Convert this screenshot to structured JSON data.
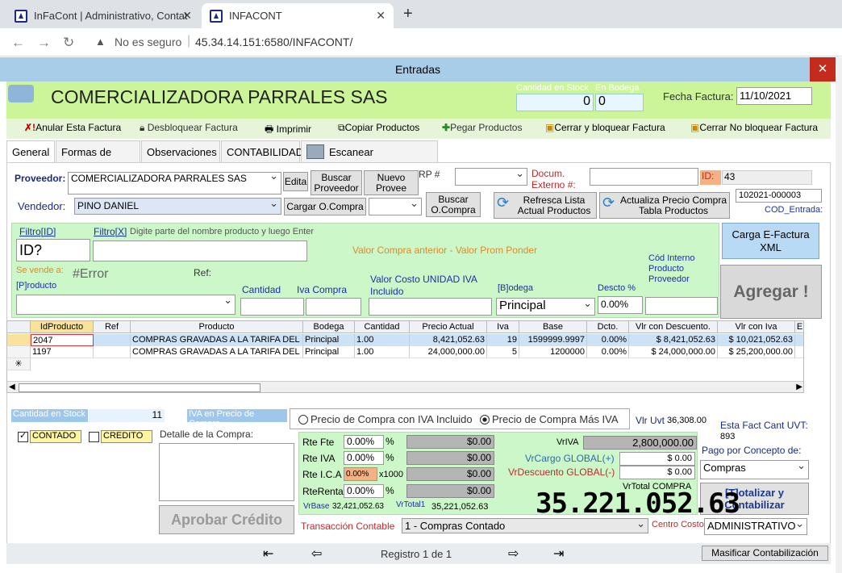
{
  "browser": {
    "tab1": "InFaCont | Administrativo, Contat",
    "tab2": "INFACONT",
    "new_tab": "+",
    "not_secure": "No es seguro",
    "url": "45.34.14.151:6580/INFACONT/"
  },
  "window": {
    "title": "Entradas",
    "close": "✕"
  },
  "header": {
    "company": "COMERCIALIZADORA PARRALES SAS",
    "stock_label": "Cantidad en Stock",
    "stock_value": "0",
    "warehouse_label": "En Bodega",
    "warehouse_value": "0",
    "invoice_date_label": "Fecha Factura:",
    "invoice_date": "11/10/2021"
  },
  "toolbar": {
    "cancel": "Anular Esta Factura",
    "unlock": "Desbloquear Factura",
    "print": "Imprimir",
    "copy": "Copiar Productos",
    "paste": "Pegar Productos",
    "close_lock": "Cerrar y bloquear Factura",
    "close_nolock": "Cerrar No bloquear Factura"
  },
  "tabs": [
    "General",
    "Formas de Pago",
    "Observaciones",
    "CONTABILIDAD",
    "Escanear Documentos"
  ],
  "form": {
    "supplier_label": "Proveedor:",
    "supplier": "COMERCIALIZADORA PARRALES SAS",
    "edit": "Edita",
    "search_supplier": "Buscar Proveedor",
    "new_supplier": "Nuevo Provee",
    "rp_label": "RP #",
    "external_doc_label": "Docum. Externo #:",
    "id_label": "ID:",
    "id_value": "43",
    "seller_label": "Vendedor:",
    "seller": "PINO DANIEL",
    "load_po": "Cargar O.Compra",
    "search_po": "Buscar O.Compra",
    "refresh": "Refresca Lista Actual Productos",
    "update_price": "Actualiza Precio Compra Tabla Productos",
    "cod_value": "102021-000003",
    "cod_label": "COD_Entrada:"
  },
  "product": {
    "filter_id_label": "Filtro[ID]",
    "filter_id": "ID?",
    "filter_x_label": "Filtro[X]",
    "filter_x_hint": "Digite parte del nombre producto y luego Enter",
    "prev_value": "Valor Compra anterior - Valor Prom Ponder",
    "sold_as": "Se vende a:",
    "error": "#Error",
    "ref": "Ref:",
    "product_label": "[P]roducto",
    "qty_label": "Cantidad",
    "iva_label": "Iva Compra",
    "unit_cost_label": "Valor Costo UNIDAD IVA Incluido",
    "warehouse_label": "[B]odega",
    "warehouse": "Principal",
    "disc_label": "Descto %",
    "discount": "0.00%",
    "code_label": "Cód Interno Producto Proveedor",
    "xml": "Carga E-Factura XML",
    "add": "Agregar !"
  },
  "grid": {
    "headers": [
      "IdProducto",
      "Ref",
      "Producto",
      "Bodega",
      "Cantidad",
      "Precio Actual",
      "Iva",
      "Base",
      "Dcto.",
      "Vlr con Descuento.",
      "Vlr con Iva",
      "E"
    ],
    "rows": [
      [
        "2047",
        "",
        "COMPRAS GRAVADAS A LA TARIFA DEL",
        "Principal",
        "1.00",
        "8,421,052.63",
        "19",
        "1599999.9997",
        "0.00%",
        "$ 8,421,052.63",
        "$ 10,021,052.63"
      ],
      [
        "1197",
        "",
        "COMPRAS GRAVADAS A LA TARIFA DEL",
        "Principal",
        "1.00",
        "24,000,000.00",
        "5",
        "1200000",
        "0.00%",
        "$ 24,000,000.00",
        "$ 25,200,000.00"
      ]
    ]
  },
  "footer": {
    "stock_label": "Cantidad en Stock",
    "stock": "11",
    "iva_price_label": "IVA en Precio de Compra",
    "cash": "CONTADO",
    "credit": "CREDITO",
    "detail_label": "Detalle de la Compra:",
    "approve": "Aprobar Crédito",
    "radio1": "Precio de Compra con IVA Incluido",
    "radio2": "Precio de Compra Más IVA",
    "uvt_label": "Vlr Uvt",
    "uvt": "36,308.00",
    "uvt_count_label": "Esta Fact Cant UVT:",
    "uvt_count": "893",
    "concept_label": "Pago por Concepto de:",
    "concept": "Compras",
    "totalize": "[T]otalizar y Contabilizar",
    "cost_center_label": "Centro Costo",
    "cost_center": "ADMINISTRATIVO",
    "transaction_label": "Transacción Contable",
    "transaction": "1 - Compras Contado"
  },
  "taxes": {
    "rtefte": "Rte Fte",
    "rtefte_pct": "0.00%",
    "rtefte_val": "$0.00",
    "rteiva": "Rte IVA",
    "rteiva_pct": "0.00%",
    "rteiva_val": "$0.00",
    "rteica": "Rte I.C.A",
    "rteica_pct": "0.00%",
    "rteica_x": "x1000",
    "rteica_val": "$0.00",
    "rterenta": "RteRenta",
    "rterenta_pct": "0.00%",
    "rterenta_val": "$0.00",
    "pct": "%",
    "vrbase_label": "VrBase",
    "vrbase": "32,421,052.63",
    "vrtotal1_label": "VrTotal1",
    "vrtotal1": "35,221,052.63",
    "vriva_label": "VrIVA",
    "vriva": "2,800,000.00",
    "cargo_label": "VrCargo GLOBAL(+)",
    "cargo": "$ 0.00",
    "desc_label": "VrDescuento GLOBAL(-)",
    "desc": "$ 0.00",
    "total_label": "VrTotal COMPRA",
    "total": "35.221.052.63"
  },
  "nav": {
    "record": "Registro 1 de 1",
    "massify": "Masificar Contabilización"
  }
}
